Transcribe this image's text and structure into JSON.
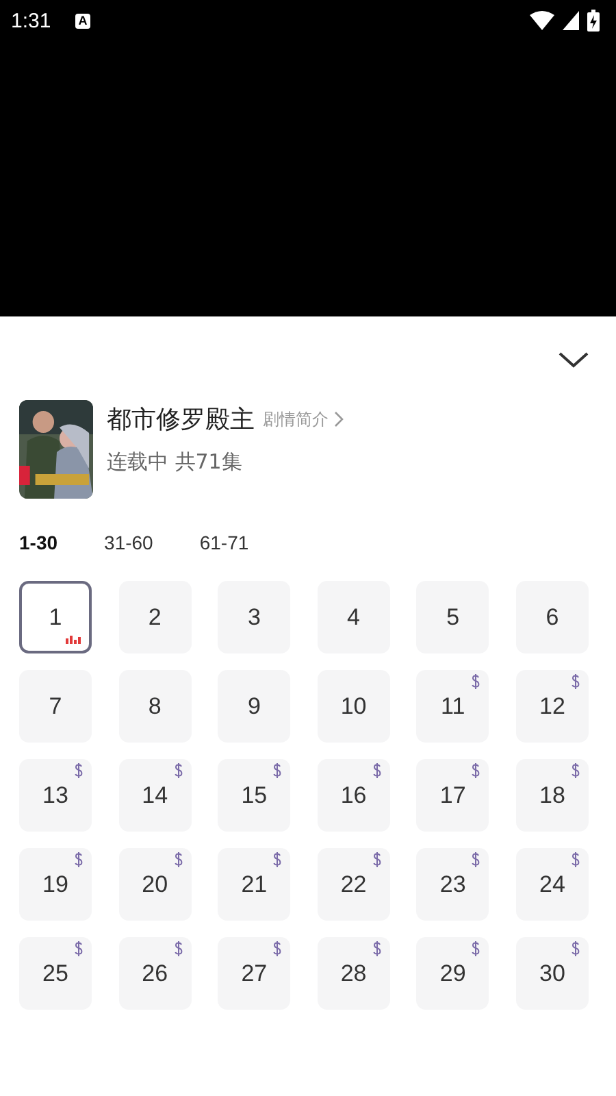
{
  "status_bar": {
    "time": "1:31",
    "notification": "A"
  },
  "drama": {
    "title": "都市修罗殿主",
    "synopsis_link": "剧情简介",
    "status": "连载中 共71集"
  },
  "ranges": [
    {
      "label": "1-30",
      "selected": true
    },
    {
      "label": "31-60",
      "selected": false
    },
    {
      "label": "61-71",
      "selected": false
    }
  ],
  "episodes": [
    {
      "number": "1",
      "selected": true,
      "playing": true,
      "locked": false
    },
    {
      "number": "2",
      "selected": false,
      "playing": false,
      "locked": false
    },
    {
      "number": "3",
      "selected": false,
      "playing": false,
      "locked": false
    },
    {
      "number": "4",
      "selected": false,
      "playing": false,
      "locked": false
    },
    {
      "number": "5",
      "selected": false,
      "playing": false,
      "locked": false
    },
    {
      "number": "6",
      "selected": false,
      "playing": false,
      "locked": false
    },
    {
      "number": "7",
      "selected": false,
      "playing": false,
      "locked": false
    },
    {
      "number": "8",
      "selected": false,
      "playing": false,
      "locked": false
    },
    {
      "number": "9",
      "selected": false,
      "playing": false,
      "locked": false
    },
    {
      "number": "10",
      "selected": false,
      "playing": false,
      "locked": false
    },
    {
      "number": "11",
      "selected": false,
      "playing": false,
      "locked": true
    },
    {
      "number": "12",
      "selected": false,
      "playing": false,
      "locked": true
    },
    {
      "number": "13",
      "selected": false,
      "playing": false,
      "locked": true
    },
    {
      "number": "14",
      "selected": false,
      "playing": false,
      "locked": true
    },
    {
      "number": "15",
      "selected": false,
      "playing": false,
      "locked": true
    },
    {
      "number": "16",
      "selected": false,
      "playing": false,
      "locked": true
    },
    {
      "number": "17",
      "selected": false,
      "playing": false,
      "locked": true
    },
    {
      "number": "18",
      "selected": false,
      "playing": false,
      "locked": true
    },
    {
      "number": "19",
      "selected": false,
      "playing": false,
      "locked": true
    },
    {
      "number": "20",
      "selected": false,
      "playing": false,
      "locked": true
    },
    {
      "number": "21",
      "selected": false,
      "playing": false,
      "locked": true
    },
    {
      "number": "22",
      "selected": false,
      "playing": false,
      "locked": true
    },
    {
      "number": "23",
      "selected": false,
      "playing": false,
      "locked": true
    },
    {
      "number": "24",
      "selected": false,
      "playing": false,
      "locked": true
    },
    {
      "number": "25",
      "selected": false,
      "playing": false,
      "locked": true
    },
    {
      "number": "26",
      "selected": false,
      "playing": false,
      "locked": true
    },
    {
      "number": "27",
      "selected": false,
      "playing": false,
      "locked": true
    },
    {
      "number": "28",
      "selected": false,
      "playing": false,
      "locked": true
    },
    {
      "number": "29",
      "selected": false,
      "playing": false,
      "locked": true
    },
    {
      "number": "30",
      "selected": false,
      "playing": false,
      "locked": true
    }
  ]
}
